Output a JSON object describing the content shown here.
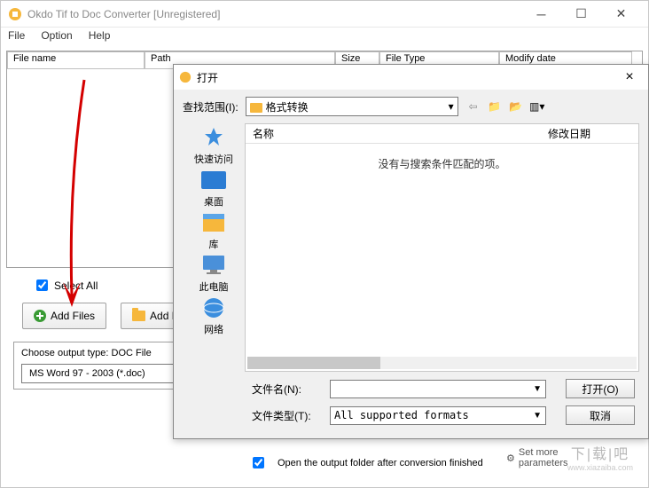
{
  "main": {
    "title": "Okdo Tif to Doc Converter  [Unregistered]",
    "menu": {
      "file": "File",
      "option": "Option",
      "help": "Help"
    },
    "columns": {
      "name": "File name",
      "path": "Path",
      "size": "Size",
      "type": "File Type",
      "date": "Modify date"
    },
    "select_all": "Select All",
    "btn_add_files": "Add Files",
    "btn_add_folder": "Add Fo",
    "output_label": "Choose output type:  DOC File",
    "output_value": "MS Word 97 - 2003 (*.doc)",
    "open_after": "Open the output folder after conversion finished",
    "set_more": "Set more parameters"
  },
  "dialog": {
    "title": "打开",
    "look_in": "查找范围(I):",
    "folder": "格式转换",
    "sidebar": [
      {
        "label": "快速访问",
        "icon": "star"
      },
      {
        "label": "桌面",
        "icon": "desktop"
      },
      {
        "label": "库",
        "icon": "library"
      },
      {
        "label": "此电脑",
        "icon": "pc"
      },
      {
        "label": "网络",
        "icon": "network"
      }
    ],
    "col_name": "名称",
    "col_date": "修改日期",
    "empty": "没有与搜索条件匹配的项。",
    "filename_label": "文件名(N):",
    "filename_value": "",
    "filetype_label": "文件类型(T):",
    "filetype_value": "All supported formats",
    "btn_open": "打开(O)",
    "btn_cancel": "取消"
  },
  "watermark": {
    "name": "下|载|吧",
    "url": "www.xiazaiba.com"
  }
}
